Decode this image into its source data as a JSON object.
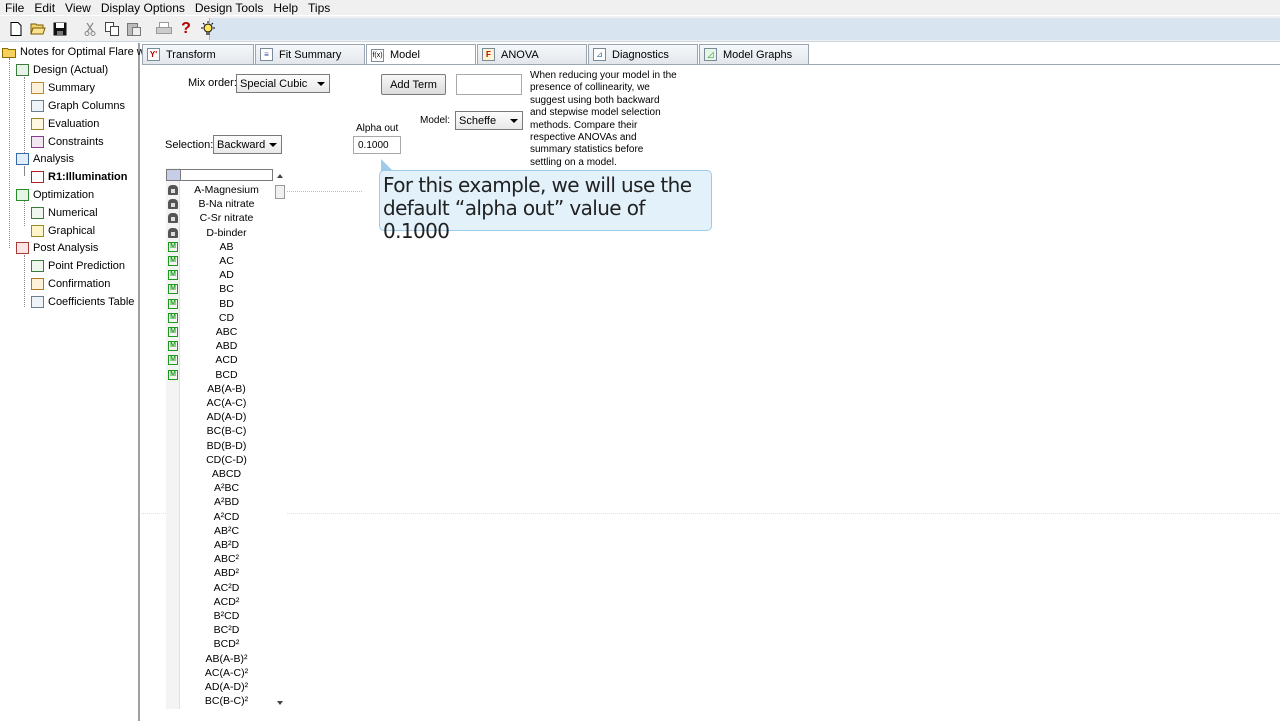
{
  "menu": [
    "File",
    "Edit",
    "View",
    "Display Options",
    "Design Tools",
    "Help",
    "Tips"
  ],
  "toolbar": {
    "icons": [
      "new-file-icon",
      "open-folder-icon",
      "save-icon",
      "cut-icon",
      "copy-icon",
      "paste-icon",
      "print-icon",
      "help-icon",
      "tip-bulb-icon"
    ],
    "help_glyph": "?"
  },
  "tree": {
    "root": "Notes for Optimal Flare wit",
    "design": "Design (Actual)",
    "summary": "Summary",
    "graph_columns": "Graph Columns",
    "evaluation": "Evaluation",
    "constraints": "Constraints",
    "analysis": "Analysis",
    "response": "R1:Illumination",
    "optimization": "Optimization",
    "numerical": "Numerical",
    "graphical": "Graphical",
    "post_analysis": "Post Analysis",
    "point_prediction": "Point Prediction",
    "confirmation": "Confirmation",
    "coefficients_table": "Coefficients Table"
  },
  "tabs": [
    {
      "label": "Transform",
      "icon": "Y'"
    },
    {
      "label": "Fit Summary",
      "icon": "≡"
    },
    {
      "label": "Model",
      "icon": "f(x)"
    },
    {
      "label": "ANOVA",
      "icon": "F"
    },
    {
      "label": "Diagnostics",
      "icon": "⊿"
    },
    {
      "label": "Model Graphs",
      "icon": "◿"
    }
  ],
  "controls": {
    "mix_order_label": "Mix order:",
    "mix_order_value": "Special Cubic",
    "add_term_label": "Add Term",
    "add_term_value": "",
    "model_label": "Model:",
    "model_value": "Scheffe",
    "selection_label": "Selection:",
    "selection_value": "Backward",
    "alpha_out_label": "Alpha out",
    "alpha_out_value": "0.1000"
  },
  "note_lines": [
    "When reducing your model in the",
    "presence of collinearity, we",
    "suggest using both backward",
    "and stepwise model selection",
    "methods. Compare their",
    "respective ANOVAs and",
    "summary statistics before",
    "settling on a model."
  ],
  "callout": {
    "line1": "For this example, we will use the",
    "line2": "default “alpha out” value of 0.1000"
  },
  "terms": [
    {
      "label": "A-Magnesium",
      "state": "lock"
    },
    {
      "label": "B-Na nitrate",
      "state": "lock"
    },
    {
      "label": "C-Sr nitrate",
      "state": "lock"
    },
    {
      "label": "D-binder",
      "state": "lock"
    },
    {
      "label": "AB",
      "state": "model"
    },
    {
      "label": "AC",
      "state": "model"
    },
    {
      "label": "AD",
      "state": "model"
    },
    {
      "label": "BC",
      "state": "model"
    },
    {
      "label": "BD",
      "state": "model"
    },
    {
      "label": "CD",
      "state": "model"
    },
    {
      "label": "ABC",
      "state": "model"
    },
    {
      "label": "ABD",
      "state": "model"
    },
    {
      "label": "ACD",
      "state": "model"
    },
    {
      "label": "BCD",
      "state": "model"
    },
    {
      "label": "AB(A-B)",
      "state": "none"
    },
    {
      "label": "AC(A-C)",
      "state": "none"
    },
    {
      "label": "AD(A-D)",
      "state": "none"
    },
    {
      "label": "BC(B-C)",
      "state": "none"
    },
    {
      "label": "BD(B-D)",
      "state": "none"
    },
    {
      "label": "CD(C-D)",
      "state": "none"
    },
    {
      "label": "ABCD",
      "state": "none"
    },
    {
      "label": "A²BC",
      "state": "none"
    },
    {
      "label": "A²BD",
      "state": "none"
    },
    {
      "label": "A²CD",
      "state": "none"
    },
    {
      "label": "AB²C",
      "state": "none"
    },
    {
      "label": "AB²D",
      "state": "none"
    },
    {
      "label": "ABC²",
      "state": "none"
    },
    {
      "label": "ABD²",
      "state": "none"
    },
    {
      "label": "AC²D",
      "state": "none"
    },
    {
      "label": "ACD²",
      "state": "none"
    },
    {
      "label": "B²CD",
      "state": "none"
    },
    {
      "label": "BC²D",
      "state": "none"
    },
    {
      "label": "BCD²",
      "state": "none"
    },
    {
      "label": "AB(A-B)²",
      "state": "none"
    },
    {
      "label": "AC(A-C)²",
      "state": "none"
    },
    {
      "label": "AD(A-D)²",
      "state": "none"
    },
    {
      "label": "BC(B-C)²",
      "state": "none"
    }
  ],
  "model_marker": "M"
}
